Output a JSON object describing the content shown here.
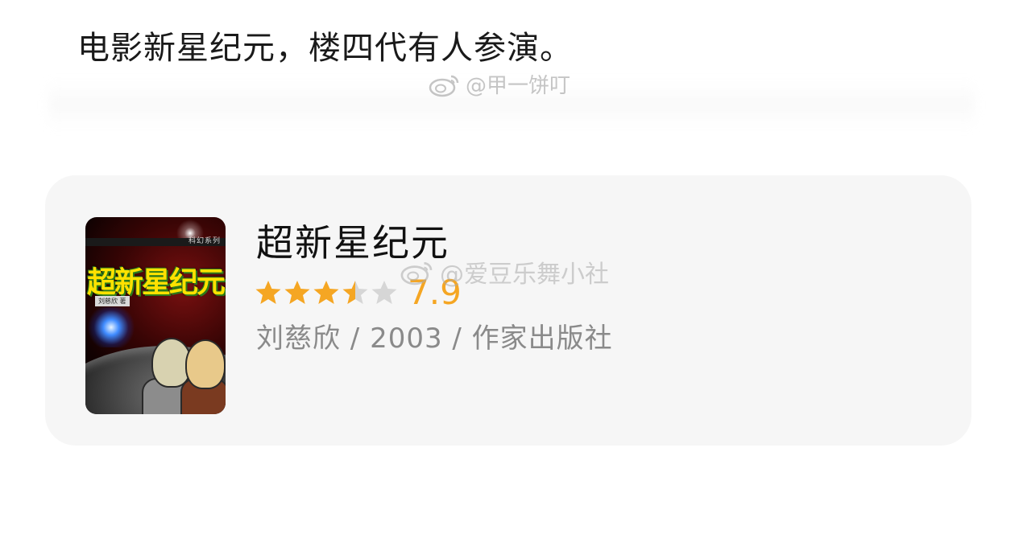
{
  "post": {
    "text": "电影新星纪元，楼四代有人参演。"
  },
  "watermarks": {
    "top": "@甲一饼叮",
    "card": "@爱豆乐舞小社"
  },
  "book_card": {
    "title": "超新星纪元",
    "rating": {
      "score": "7.9",
      "stars_out_of_5": 3.5,
      "star_color": "#f5a623",
      "empty_star_color": "#d6d6d6"
    },
    "meta": "刘慈欣 / 2003 / 作家出版社",
    "cover": {
      "title": "超新星纪元",
      "series": "科幻系列",
      "author": "刘慈欣 著"
    }
  }
}
